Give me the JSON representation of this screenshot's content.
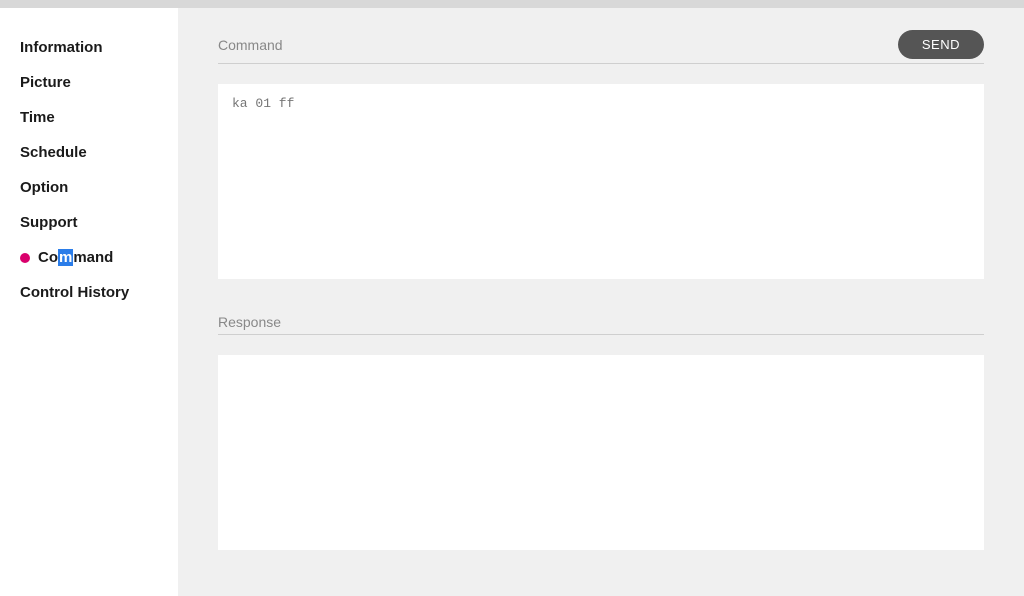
{
  "sidebar": {
    "items": [
      {
        "label": "Information",
        "active": false
      },
      {
        "label": "Picture",
        "active": false
      },
      {
        "label": "Time",
        "active": false
      },
      {
        "label": "Schedule",
        "active": false
      },
      {
        "label": "Option",
        "active": false
      },
      {
        "label": "Support",
        "active": false
      },
      {
        "label": "Command",
        "active": true,
        "pre": "Co",
        "hl": "m",
        "post": "mand"
      },
      {
        "label": "Control History",
        "active": false
      }
    ]
  },
  "main": {
    "command": {
      "title": "Command",
      "placeholder": "ka 01 ff",
      "send_label": "SEND"
    },
    "response": {
      "title": "Response",
      "value": ""
    }
  }
}
